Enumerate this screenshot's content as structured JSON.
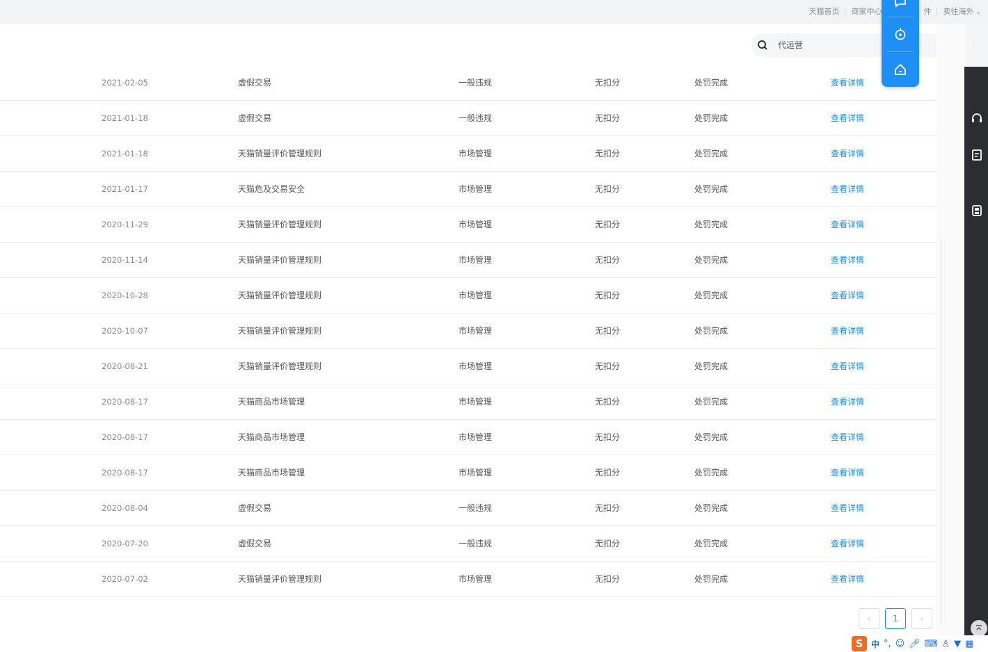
{
  "topbar": {
    "links": [
      "天猫首页",
      "商家中心",
      "件",
      "卖往海外"
    ]
  },
  "search": {
    "placeholder": "代运营"
  },
  "table": {
    "rows": [
      {
        "date": "2021-02-05",
        "rule": "虚假交易",
        "type": "一般违规",
        "points": "无扣分",
        "status": "处罚完成",
        "action": "查看详情"
      },
      {
        "date": "2021-01-18",
        "rule": "虚假交易",
        "type": "一般违规",
        "points": "无扣分",
        "status": "处罚完成",
        "action": "查看详情"
      },
      {
        "date": "2021-01-18",
        "rule": "天猫销量评价管理规则",
        "type": "市场管理",
        "points": "无扣分",
        "status": "处罚完成",
        "action": "查看详情"
      },
      {
        "date": "2021-01-17",
        "rule": "天猫危及交易安全",
        "type": "市场管理",
        "points": "无扣分",
        "status": "处罚完成",
        "action": "查看详情"
      },
      {
        "date": "2020-11-29",
        "rule": "天猫销量评价管理规则",
        "type": "市场管理",
        "points": "无扣分",
        "status": "处罚完成",
        "action": "查看详情"
      },
      {
        "date": "2020-11-14",
        "rule": "天猫销量评价管理规则",
        "type": "市场管理",
        "points": "无扣分",
        "status": "处罚完成",
        "action": "查看详情"
      },
      {
        "date": "2020-10-28",
        "rule": "天猫销量评价管理规则",
        "type": "市场管理",
        "points": "无扣分",
        "status": "处罚完成",
        "action": "查看详情"
      },
      {
        "date": "2020-10-07",
        "rule": "天猫销量评价管理规则",
        "type": "市场管理",
        "points": "无扣分",
        "status": "处罚完成",
        "action": "查看详情"
      },
      {
        "date": "2020-08-21",
        "rule": "天猫销量评价管理规则",
        "type": "市场管理",
        "points": "无扣分",
        "status": "处罚完成",
        "action": "查看详情"
      },
      {
        "date": "2020-08-17",
        "rule": "天猫商品市场管理",
        "type": "市场管理",
        "points": "无扣分",
        "status": "处罚完成",
        "action": "查看详情"
      },
      {
        "date": "2020-08-17",
        "rule": "天猫商品市场管理",
        "type": "市场管理",
        "points": "无扣分",
        "status": "处罚完成",
        "action": "查看详情"
      },
      {
        "date": "2020-08-17",
        "rule": "天猫商品市场管理",
        "type": "市场管理",
        "points": "无扣分",
        "status": "处罚完成",
        "action": "查看详情"
      },
      {
        "date": "2020-08-04",
        "rule": "虚假交易",
        "type": "一般违规",
        "points": "无扣分",
        "status": "处罚完成",
        "action": "查看详情"
      },
      {
        "date": "2020-07-20",
        "rule": "虚假交易",
        "type": "一般违规",
        "points": "无扣分",
        "status": "处罚完成",
        "action": "查看详情"
      },
      {
        "date": "2020-07-02",
        "rule": "天猫销量评价管理规则",
        "type": "市场管理",
        "points": "无扣分",
        "status": "处罚完成",
        "action": "查看详情"
      }
    ]
  },
  "pagination": {
    "prev": "‹",
    "current": "1",
    "next": "›"
  },
  "ime": {
    "logo": "S",
    "lang": "中",
    "punct": "°,"
  },
  "icons": {
    "search": "search-icon",
    "float": [
      "message-icon",
      "target-icon",
      "home-icon"
    ],
    "sidebar": [
      "headset-icon",
      "edit-note-icon",
      "save-icon",
      "back-to-top-icon"
    ]
  },
  "colors": {
    "accent": "#1a8ff0",
    "float_panel": "#1e90f5",
    "sidebar": "#2b2d31",
    "ime_logo": "#f26a22"
  }
}
